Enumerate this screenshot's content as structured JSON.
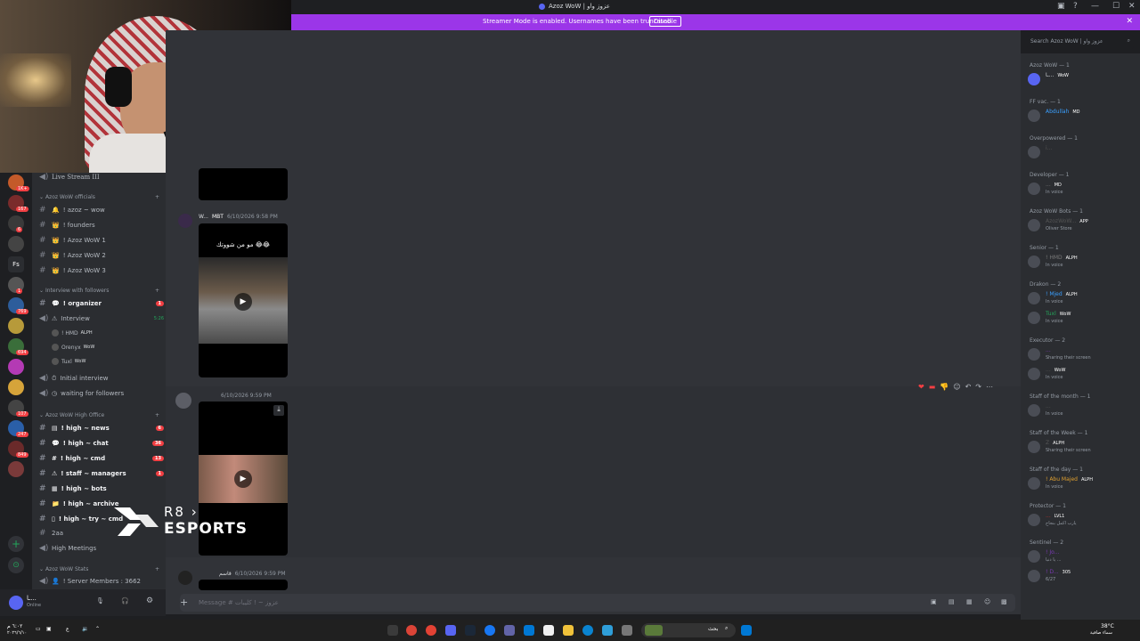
{
  "window": {
    "title": "Azoz WoW | عزوز واو",
    "min": "—",
    "max": "☐",
    "close": "✕",
    "inbox": "▣",
    "help": "?"
  },
  "banner": {
    "message": "Streamer Mode is enabled. Usernames have been truncated.",
    "disable_label": "Disable",
    "close": "✕"
  },
  "toolbar": {
    "search_placeholder": "Search Azoz WoW | عزوز واو"
  },
  "servers": [
    {
      "label": "",
      "badge": "1K+",
      "color": "#c45a2a"
    },
    {
      "label": "",
      "badge": "167",
      "color": "#7a2b2b"
    },
    {
      "label": "",
      "badge": "6",
      "color": "#3a3a3a"
    },
    {
      "label": "",
      "badge": "",
      "color": "#444"
    },
    {
      "label": "Fs",
      "badge": "",
      "color": "#2b2d31"
    },
    {
      "label": "",
      "badge": "1",
      "color": "#555"
    },
    {
      "label": "",
      "badge": "769",
      "color": "#2d5d9b"
    },
    {
      "label": "",
      "badge": "",
      "color": "#b79a3a"
    },
    {
      "label": "",
      "badge": "694",
      "color": "#3a6e3a"
    },
    {
      "label": "",
      "badge": "",
      "color": "#b43ab4"
    },
    {
      "label": "",
      "badge": "",
      "color": "#d6a43a"
    },
    {
      "label": "",
      "badge": "107",
      "color": "#444"
    },
    {
      "label": "",
      "badge": "247",
      "color": "#2a5fa8"
    },
    {
      "label": "",
      "badge": "849",
      "color": "#6a2a2a"
    },
    {
      "label": "",
      "badge": "",
      "color": "#7a3a3a"
    }
  ],
  "channels": {
    "live_stream": "Live Stream III",
    "cat_officials": "Azoz WoW officials",
    "officials": [
      "! azoz ~ wow",
      "! founders",
      "! Azoz WoW 1",
      "! Azoz WoW 2",
      "! Azoz WoW 3"
    ],
    "cat_interview": "Interview with followers",
    "organizer": "! organizer",
    "organizer_badge": "1",
    "interview": "Interview",
    "interview_time": "5:26",
    "voice_users": [
      {
        "name": "! HMD",
        "tag": "ALPH"
      },
      {
        "name": "Orenyx",
        "tag": "WoW"
      },
      {
        "name": "Tuxl",
        "tag": "WoW"
      }
    ],
    "initial_interview": "Initial interview",
    "waiting": "waiting for followers",
    "cat_high": "Azoz WoW High Office",
    "high": [
      {
        "name": "! high ~ news",
        "badge": "6"
      },
      {
        "name": "! high ~ chat",
        "badge": "36"
      },
      {
        "name": "! high ~ cmd",
        "badge": "13"
      },
      {
        "name": "! staff ~ managers",
        "badge": "1"
      },
      {
        "name": "! high ~ bots",
        "badge": ""
      },
      {
        "name": "! high ~ archive",
        "badge": ""
      },
      {
        "name": "! high ~ try ~ cmd",
        "badge": ""
      }
    ],
    "zaa": "2aa",
    "high_meetings": "High Meetings",
    "cat_stats": "Azoz WoW Stats",
    "members_stat": "! Server Members : 3662"
  },
  "userbar": {
    "name": "ـا...",
    "status": "Online"
  },
  "messages": [
    {
      "author": "W...",
      "tag": "MBT",
      "time": "6/10/2026 9:58 PM",
      "caption": "مو من شووتك 😂😂"
    },
    {
      "author": "",
      "tag": "",
      "time": "6/10/2026 9:59 PM",
      "caption": ""
    },
    {
      "author": "قاسم",
      "tag": "",
      "time": "6/10/2026 9:59 PM",
      "caption": ""
    }
  ],
  "composer": {
    "placeholder": "Message # عزوز ~ ! كليبات"
  },
  "members": [
    {
      "category": "Azoz WoW — 1",
      "users": [
        {
          "name": "ـا...",
          "tag": "WoW",
          "status": "",
          "color": "#dbdee1"
        }
      ]
    },
    {
      "category": "FF vac. — 1",
      "users": [
        {
          "name": "Abdullah",
          "tag": "MD",
          "status": "",
          "color": "#3aa0ff"
        }
      ]
    },
    {
      "category": "Overpowered — 1",
      "users": [
        {
          "name": "i...",
          "tag": "",
          "status": "",
          "color": "#555"
        }
      ]
    },
    {
      "category": "Developer — 1",
      "users": [
        {
          "name": "...",
          "tag": "MD",
          "status": "In voice",
          "color": "#7a7a7a"
        }
      ]
    },
    {
      "category": "Azoz WoW Bots — 1",
      "users": [
        {
          "name": "AzozWoW...",
          "tag": "APP",
          "status": "Oliver Store",
          "color": "#555"
        }
      ]
    },
    {
      "category": "Senior — 1",
      "users": [
        {
          "name": "! HMD",
          "tag": "ALPH",
          "status": "In voice",
          "color": "#7a7a7a"
        }
      ]
    },
    {
      "category": "Drakon — 2",
      "users": [
        {
          "name": "! Mjed",
          "tag": "ALPH",
          "status": "In voice",
          "color": "#3aa0ff"
        },
        {
          "name": "Tuxl",
          "tag": "WoW",
          "status": "In voice",
          "color": "#23a55a"
        }
      ]
    },
    {
      "category": "Executor — 2",
      "users": [
        {
          "name": "...",
          "tag": "",
          "status": "Sharing their screen",
          "color": "#7a3ab4"
        },
        {
          "name": "...",
          "tag": "WoW",
          "status": "In voice",
          "color": "#555"
        }
      ]
    },
    {
      "category": "Staff of the month — 1",
      "users": [
        {
          "name": "...",
          "tag": "",
          "status": "In voice",
          "color": "#555"
        }
      ]
    },
    {
      "category": "Staff of the Week — 1",
      "users": [
        {
          "name": "Z",
          "tag": "ALPH",
          "status": "Sharing their screen",
          "color": "#555"
        }
      ]
    },
    {
      "category": "Staff of the day — 1",
      "users": [
        {
          "name": "! Abu Majed",
          "tag": "ALPH",
          "status": "In voice",
          "color": "#e0a030"
        }
      ]
    },
    {
      "category": "Protector — 1",
      "users": [
        {
          "name": "...",
          "tag": "LVL1",
          "status": "يارب اكمل بنجاح",
          "color": "#c4302b"
        }
      ]
    },
    {
      "category": "Sentinel — 2",
      "users": [
        {
          "name": "! Jo...",
          "tag": "",
          "status": "يا دنيا ...",
          "color": "#7a3ab4"
        },
        {
          "name": "! D...",
          "tag": "305",
          "status": "6/27",
          "color": "#7a3ab4"
        }
      ]
    }
  ],
  "logo": {
    "line1": "R8 ›",
    "line2": "ESPORTS"
  },
  "taskbar": {
    "search": "بحث",
    "weather": "38°C",
    "weather_sub": "سماء صافية",
    "time": "٦:٠٢ م",
    "date": "٢٠٢٦/٦/١٠"
  }
}
